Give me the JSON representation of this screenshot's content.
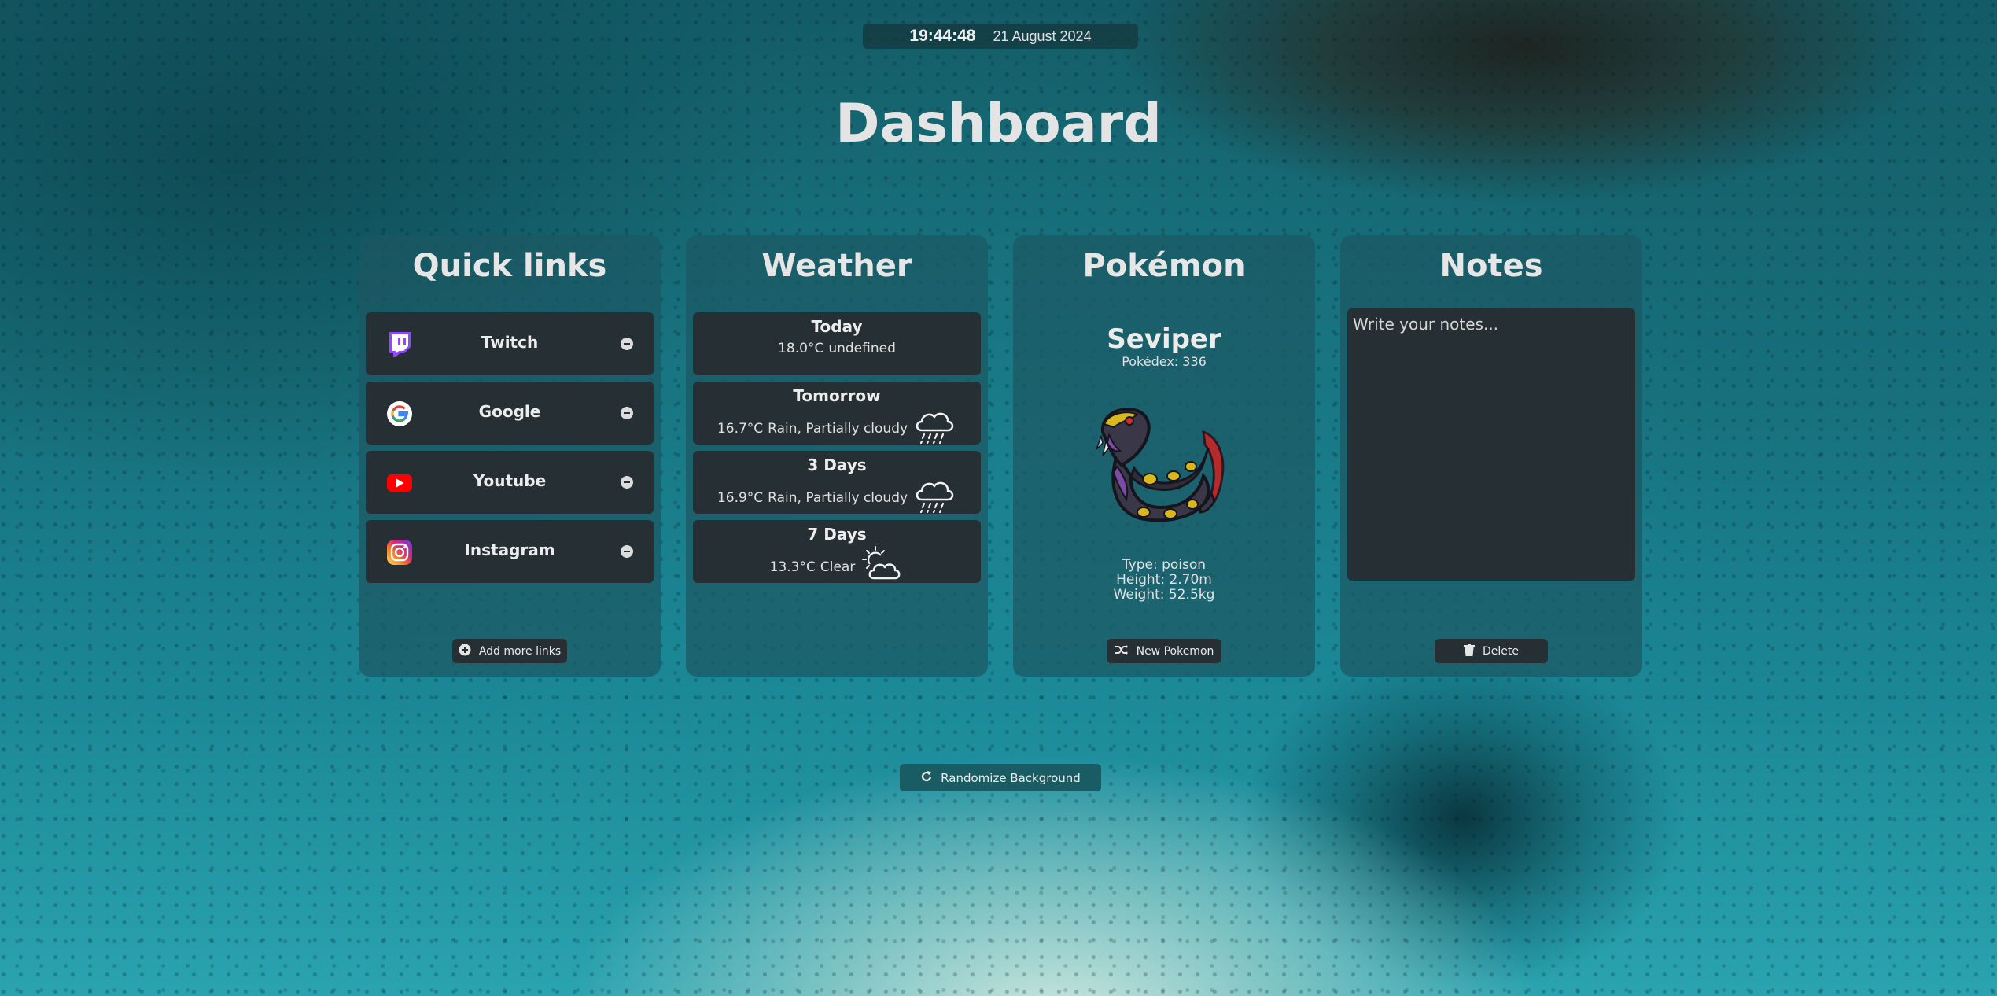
{
  "clock": {
    "time": "19:44:48",
    "date": "21 August 2024"
  },
  "page_title": "Dashboard",
  "quick_links": {
    "title": "Quick links",
    "links": [
      {
        "name": "Twitch",
        "icon": "twitch-icon"
      },
      {
        "name": "Google",
        "icon": "google-icon"
      },
      {
        "name": "Youtube",
        "icon": "youtube-icon"
      },
      {
        "name": "Instagram",
        "icon": "instagram-icon"
      }
    ],
    "add_label": "Add more links"
  },
  "weather": {
    "title": "Weather",
    "days": [
      {
        "label": "Today",
        "temp": "18.0°C",
        "condition": "undefined",
        "icon": ""
      },
      {
        "label": "Tomorrow",
        "temp": "16.7°C",
        "condition": "Rain, Partially cloudy",
        "icon": "rain-cloud-icon"
      },
      {
        "label": "3 Days",
        "temp": "16.9°C",
        "condition": "Rain, Partially cloudy",
        "icon": "rain-cloud-icon"
      },
      {
        "label": "7 Days",
        "temp": "13.3°C",
        "condition": "Clear",
        "icon": "sun-cloud-icon"
      }
    ]
  },
  "pokemon": {
    "title": "Pokémon",
    "name": "Seviper",
    "pokedex": "Pokédex: 336",
    "type": "Type: poison",
    "height": "Height: 2.70m",
    "weight": "Weight: 52.5kg",
    "button_label": "New Pokemon"
  },
  "notes": {
    "title": "Notes",
    "placeholder": "Write your notes...",
    "delete_label": "Delete"
  },
  "randomize_label": "Randomize Background",
  "colors": {
    "card_bg": "#1c5862",
    "item_bg": "#262f33",
    "button_teal": "#1a5c63",
    "text": "#e6e6e6"
  }
}
